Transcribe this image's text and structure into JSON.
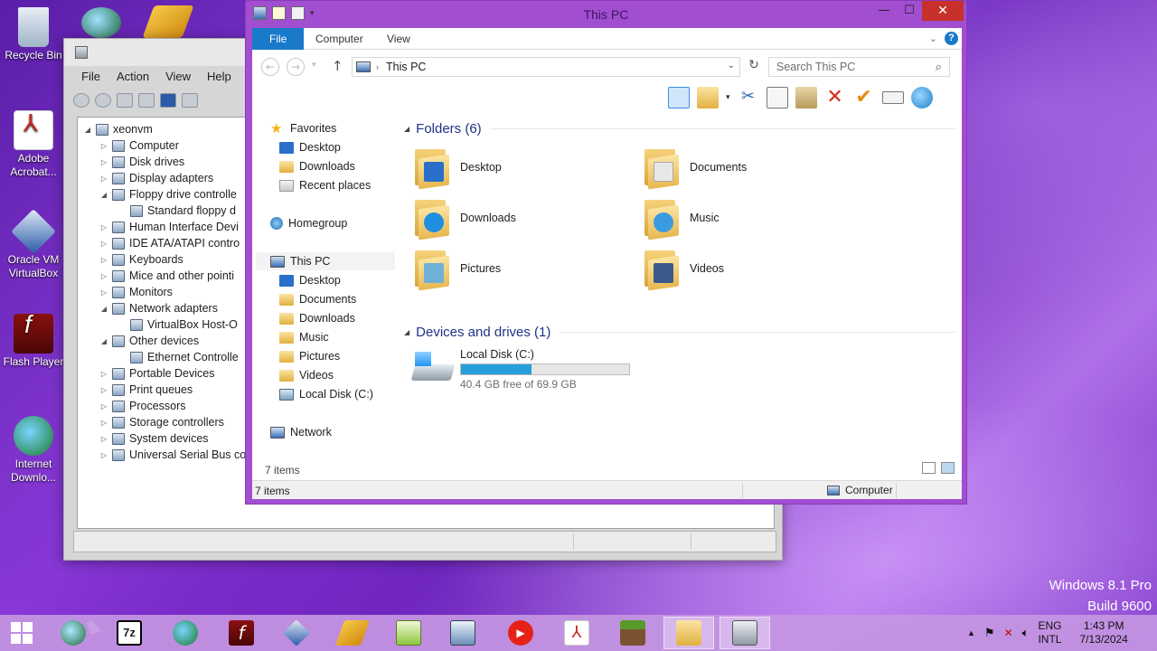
{
  "desktop": {
    "icons": [
      {
        "label": "Recycle Bin",
        "icon": "recycle-bin-icon"
      },
      {
        "label": "Adobe Acrobat...",
        "icon": "adobe-acrobat-icon"
      },
      {
        "label": "Oracle VM VirtualBox",
        "icon": "virtualbox-icon"
      },
      {
        "label": "Flash Player",
        "icon": "flash-player-icon"
      },
      {
        "label": "Internet Downlo...",
        "icon": "internet-download-manager-icon"
      }
    ],
    "watermark": {
      "line1": "Windows 8.1 Pro",
      "line2": "Build 9600"
    }
  },
  "device_manager": {
    "menu": [
      "File",
      "Action",
      "View",
      "Help"
    ],
    "tree": [
      {
        "label": "xeonvm",
        "level": 0,
        "expander": "◢"
      },
      {
        "label": "Computer",
        "level": 1,
        "expander": "▷"
      },
      {
        "label": "Disk drives",
        "level": 1,
        "expander": "▷"
      },
      {
        "label": "Display adapters",
        "level": 1,
        "expander": "▷"
      },
      {
        "label": "Floppy drive controlle",
        "level": 1,
        "expander": "◢"
      },
      {
        "label": "Standard floppy d",
        "level": 2,
        "expander": ""
      },
      {
        "label": "Human Interface Devi",
        "level": 1,
        "expander": "▷"
      },
      {
        "label": "IDE ATA/ATAPI contro",
        "level": 1,
        "expander": "▷"
      },
      {
        "label": "Keyboards",
        "level": 1,
        "expander": "▷"
      },
      {
        "label": "Mice and other pointi",
        "level": 1,
        "expander": "▷"
      },
      {
        "label": "Monitors",
        "level": 1,
        "expander": "▷"
      },
      {
        "label": "Network adapters",
        "level": 1,
        "expander": "◢"
      },
      {
        "label": "VirtualBox Host-O",
        "level": 2,
        "expander": ""
      },
      {
        "label": "Other devices",
        "level": 1,
        "expander": "◢"
      },
      {
        "label": "Ethernet Controlle",
        "level": 2,
        "expander": ""
      },
      {
        "label": "Portable Devices",
        "level": 1,
        "expander": "▷"
      },
      {
        "label": "Print queues",
        "level": 1,
        "expander": "▷"
      },
      {
        "label": "Processors",
        "level": 1,
        "expander": "▷"
      },
      {
        "label": "Storage controllers",
        "level": 1,
        "expander": "▷"
      },
      {
        "label": "System devices",
        "level": 1,
        "expander": "▷"
      },
      {
        "label": "Universal Serial Bus co",
        "level": 1,
        "expander": "▷"
      }
    ]
  },
  "explorer": {
    "title": "This PC",
    "ribbon_tabs": {
      "file": "File",
      "computer": "Computer",
      "view": "View"
    },
    "address": "This PC",
    "search_placeholder": "Search This PC",
    "nav": {
      "favorites": "Favorites",
      "fav_items": [
        "Desktop",
        "Downloads",
        "Recent places"
      ],
      "homegroup": "Homegroup",
      "this_pc": "This PC",
      "pc_items": [
        "Desktop",
        "Documents",
        "Downloads",
        "Music",
        "Pictures",
        "Videos",
        "Local Disk (C:)"
      ],
      "network": "Network"
    },
    "folders_header": "Folders (6)",
    "folders": [
      {
        "label": "Desktop",
        "badge": "#2a6fc9"
      },
      {
        "label": "Documents",
        "badge": "#e8e8e8"
      },
      {
        "label": "Downloads",
        "badge": "#1f8fe0"
      },
      {
        "label": "Music",
        "badge": "#3a9be0"
      },
      {
        "label": "Pictures",
        "badge": "#6fb0d8"
      },
      {
        "label": "Videos",
        "badge": "#3a5a8a"
      }
    ],
    "devices_header": "Devices and drives (1)",
    "drive": {
      "name": "Local Disk (C:)",
      "free_text": "40.4 GB free of 69.9 GB",
      "used_fraction": 0.42
    },
    "items_count": "7 items",
    "status_left": "7 items",
    "status_right": "Computer"
  },
  "taskbar": {
    "apps": [
      "start",
      "ie-like",
      "7zip",
      "idm",
      "flash",
      "virtualbox",
      "winamp",
      "notepad++",
      "remote",
      "youtube",
      "acrobat",
      "minecraft",
      "file-explorer",
      "device-manager"
    ],
    "lang_top": "ENG",
    "lang_bottom": "INTL",
    "time": "1:43 PM",
    "date": "7/13/2024"
  },
  "colors": {
    "accent": "#1979ca",
    "window_border": "#a14ed0",
    "drive_fill": "#26a0da"
  }
}
